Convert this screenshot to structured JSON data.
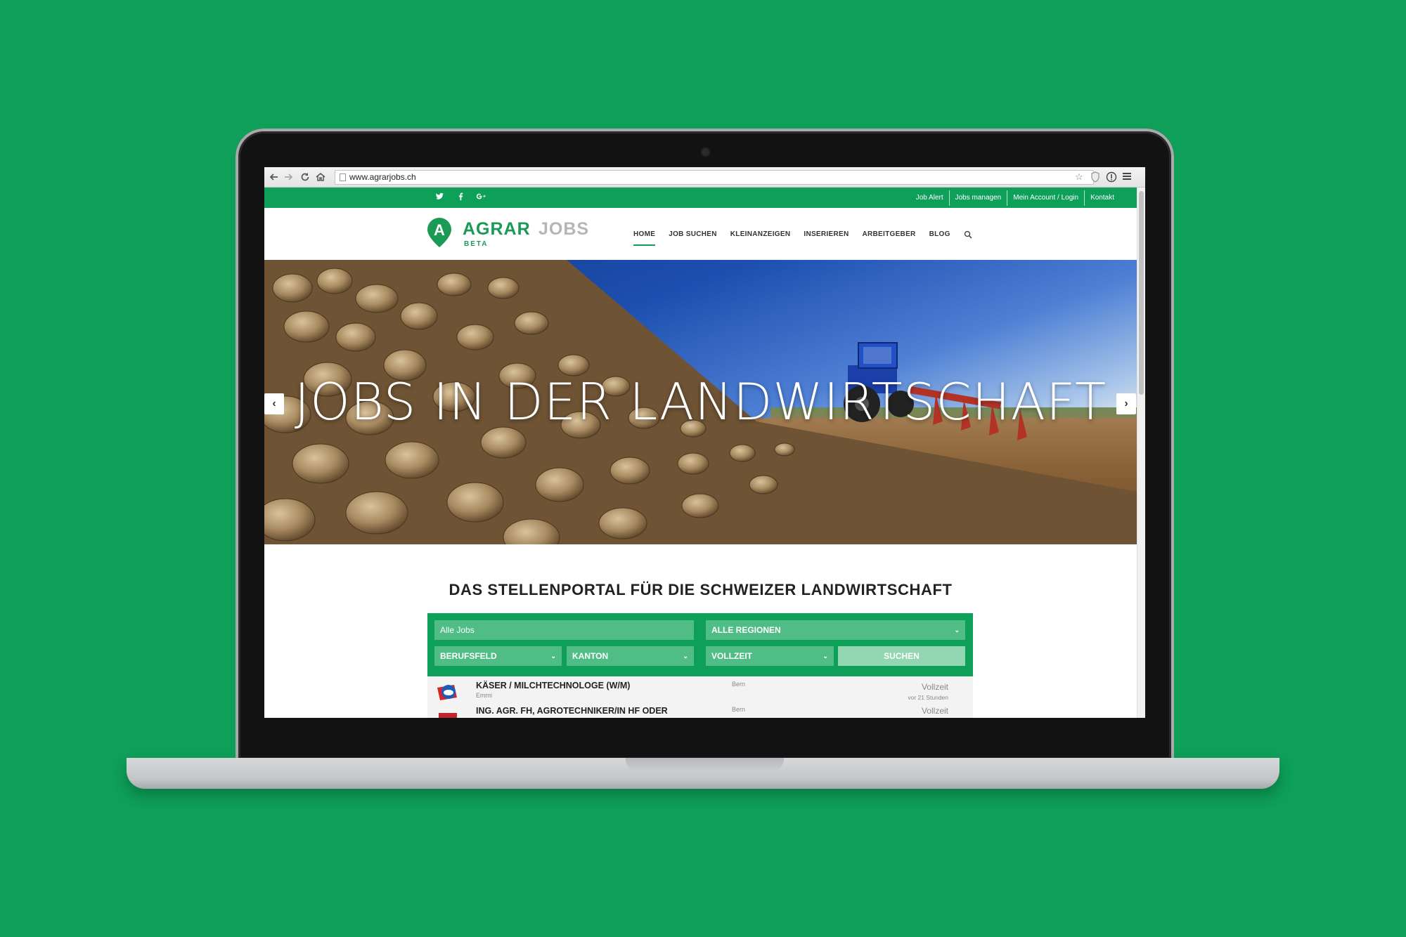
{
  "browser": {
    "url": "www.agrarjobs.ch"
  },
  "topbar": {
    "links": [
      "Job Alert",
      "Jobs managen",
      "Mein Account / Login",
      "Kontakt"
    ]
  },
  "logo": {
    "letter": "A",
    "agrar": "AGRAR",
    "jobs": "JOBS",
    "beta": "BETA"
  },
  "menu": {
    "items": [
      "HOME",
      "JOB SUCHEN",
      "KLEINANZEIGEN",
      "INSERIEREN",
      "ARBEITGEBER",
      "BLOG"
    ],
    "active": "HOME"
  },
  "hero": {
    "title": "JOBS IN DER LANDWIRTSCHAFT"
  },
  "portal": {
    "title": "DAS STELLENPORTAL FÜR DIE SCHWEIZER LANDWIRTSCHAFT"
  },
  "search": {
    "keyword": "Alle Jobs",
    "region": "ALLE REGIONEN",
    "field": "BERUFSFELD",
    "canton": "KANTON",
    "workload": "VOLLZEIT",
    "submit": "SUCHEN",
    "chevron": "⌄"
  },
  "jobs": [
    {
      "title": "KÄSER / MILCHTECHNOLOGE (W/M)",
      "company": "Emmi",
      "location": "Bern",
      "type": "Vollzeit",
      "posted": "vor 21 Stunden"
    },
    {
      "title": "ING. AGR. FH, AGROTECHNIKER/IN HF ODER",
      "company": "",
      "location": "Bern",
      "type": "Vollzeit",
      "posted": ""
    }
  ],
  "colors": {
    "background": "#0e9f58",
    "brand_green": "#0e9f58",
    "field_green": "#4fbd85",
    "button_green": "#92d6b2",
    "logo_grey": "#b6b6b6"
  },
  "icons": {
    "social": [
      "twitter-icon",
      "facebook-icon",
      "google-plus-icon"
    ],
    "browser": [
      "back-icon",
      "forward-icon",
      "reload-icon",
      "home-icon",
      "star-icon",
      "shield-icon",
      "info-icon",
      "menu-icon"
    ],
    "hero": [
      "chevron-left-icon",
      "chevron-right-icon"
    ]
  }
}
